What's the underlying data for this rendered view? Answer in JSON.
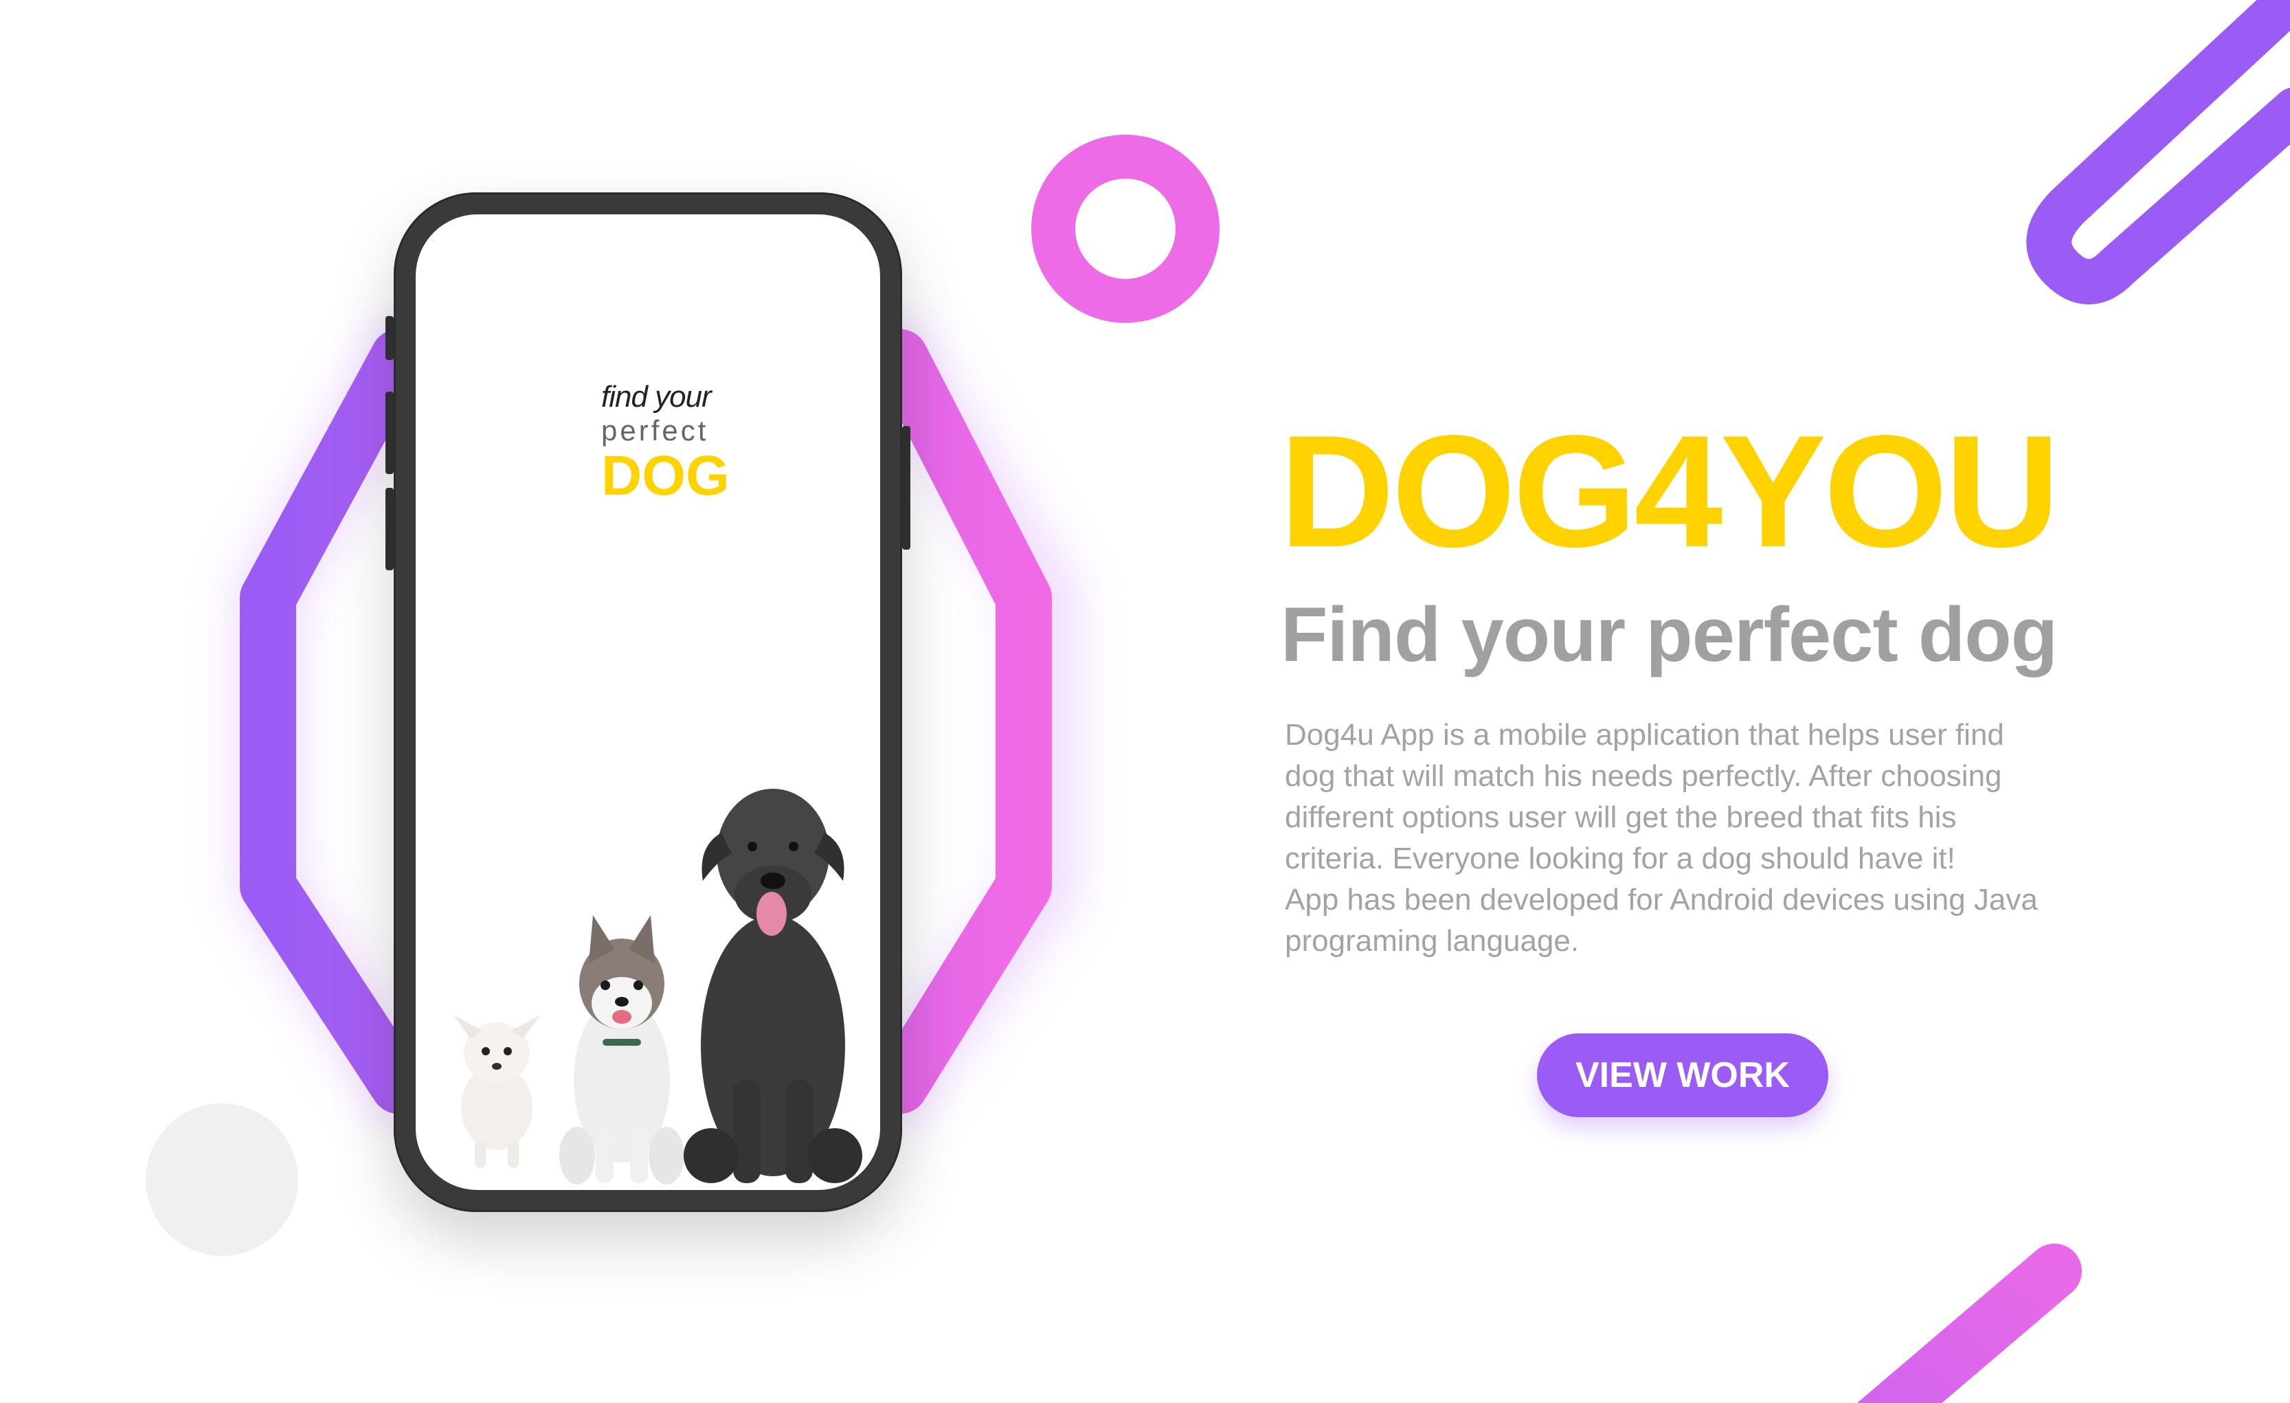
{
  "colors": {
    "brand_yellow": "#FFD200",
    "accent_purple": "#9A5CF5",
    "accent_pink": "#EE6BE8",
    "subtitle_gray": "#a0a0a0",
    "body_gray": "#a3a3a3",
    "circle_gray": "#f0f0f0"
  },
  "phone_screen": {
    "logo_line1": "find your",
    "logo_line2": "perfect",
    "logo_line3": "DOG"
  },
  "hero": {
    "title": "DOG4YOU",
    "subtitle": "Find your perfect dog",
    "description_lines": [
      "Dog4u App is a mobile application that helps user find",
      "dog that will match his needs perfectly. After choosing",
      "different options user will get the breed that fits his",
      "criteria. Everyone looking for a dog should have it!",
      "App has been developed for Android devices using Java",
      "programing language."
    ]
  },
  "cta": {
    "view_work_label": "VIEW WORK"
  },
  "icons": {
    "dogs": [
      "chihuahua-puppy",
      "husky-puppy",
      "cane-corso"
    ]
  }
}
